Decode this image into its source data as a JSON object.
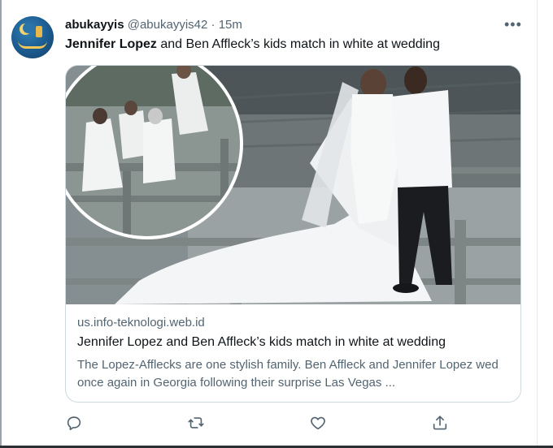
{
  "tweet": {
    "author_name": "abukayyis",
    "author_handle": "@abukayyis42",
    "separator": "·",
    "time": "15m",
    "text_bold": "Jennifer Lopez",
    "text_rest": " and Ben Affleck’s kids match in white at wedding"
  },
  "card": {
    "domain": "us.info-teknologi.web.id",
    "title": "Jennifer Lopez and Ben Affleck’s kids match in white at wedding",
    "description": "The Lopez-Afflecks are one stylish family. Ben Affleck and Jennifer Lopez wed once again in Georgia following their surprise Las Vegas ..."
  },
  "icons": {
    "more": "more-icon",
    "reply": "reply-icon",
    "retweet": "retweet-icon",
    "like": "like-icon",
    "share": "share-icon"
  },
  "colors": {
    "text_primary": "#0f1419",
    "text_secondary": "#536471",
    "border": "#cfd9de"
  }
}
